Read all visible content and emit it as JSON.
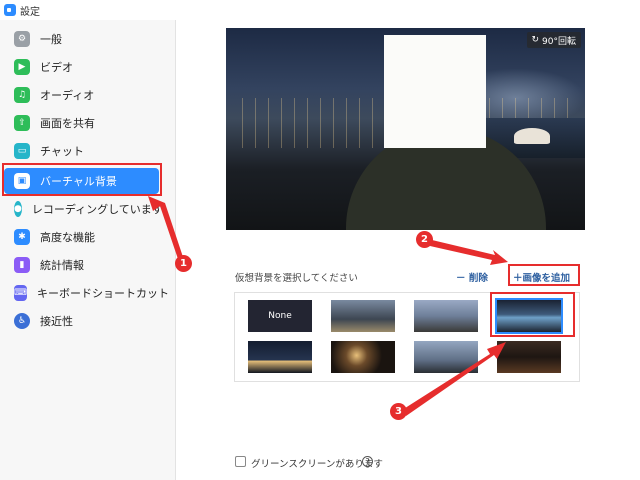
{
  "window": {
    "title": "設定"
  },
  "sidebar": {
    "items": [
      {
        "label": "一般",
        "icon": "gear-icon",
        "color": "#9aa0a6"
      },
      {
        "label": "ビデオ",
        "icon": "video-camera-icon",
        "color": "#2ebd59"
      },
      {
        "label": "オーディオ",
        "icon": "headphones-icon",
        "color": "#2ebd59"
      },
      {
        "label": "画面を共有",
        "icon": "share-screen-icon",
        "color": "#2ebd59"
      },
      {
        "label": "チャット",
        "icon": "chat-icon",
        "color": "#26b5c9"
      },
      {
        "label": "バーチャル背景",
        "icon": "portrait-icon",
        "color": "#2d8cff"
      },
      {
        "label": "レコーディングしています",
        "icon": "record-icon",
        "color": "#26b5c9"
      },
      {
        "label": "高度な機能",
        "icon": "advanced-icon",
        "color": "#2d8cff"
      },
      {
        "label": "統計情報",
        "icon": "stats-icon",
        "color": "#8b5cf6"
      },
      {
        "label": "キーボードショートカット",
        "icon": "keyboard-icon",
        "color": "#6366f1"
      },
      {
        "label": "接近性",
        "icon": "accessibility-icon",
        "color": "#3b6fd6"
      }
    ]
  },
  "preview": {
    "rotate_label": "90°回転"
  },
  "virtual_bg": {
    "choose_label": "仮想背景を選択してください",
    "delete_label": "削除",
    "add_label": "画像を追加",
    "thumbnails": [
      {
        "label": "None"
      },
      {
        "label": ""
      },
      {
        "label": ""
      },
      {
        "label": ""
      },
      {
        "label": ""
      },
      {
        "label": ""
      },
      {
        "label": ""
      },
      {
        "label": ""
      }
    ]
  },
  "green_screen": {
    "label": "グリーンスクリーンがあります",
    "help": "?"
  },
  "annotations": {
    "badges": [
      "1",
      "2",
      "3"
    ]
  },
  "colors": {
    "accent": "#2d8cff",
    "annotation_red": "#e62d2d"
  }
}
